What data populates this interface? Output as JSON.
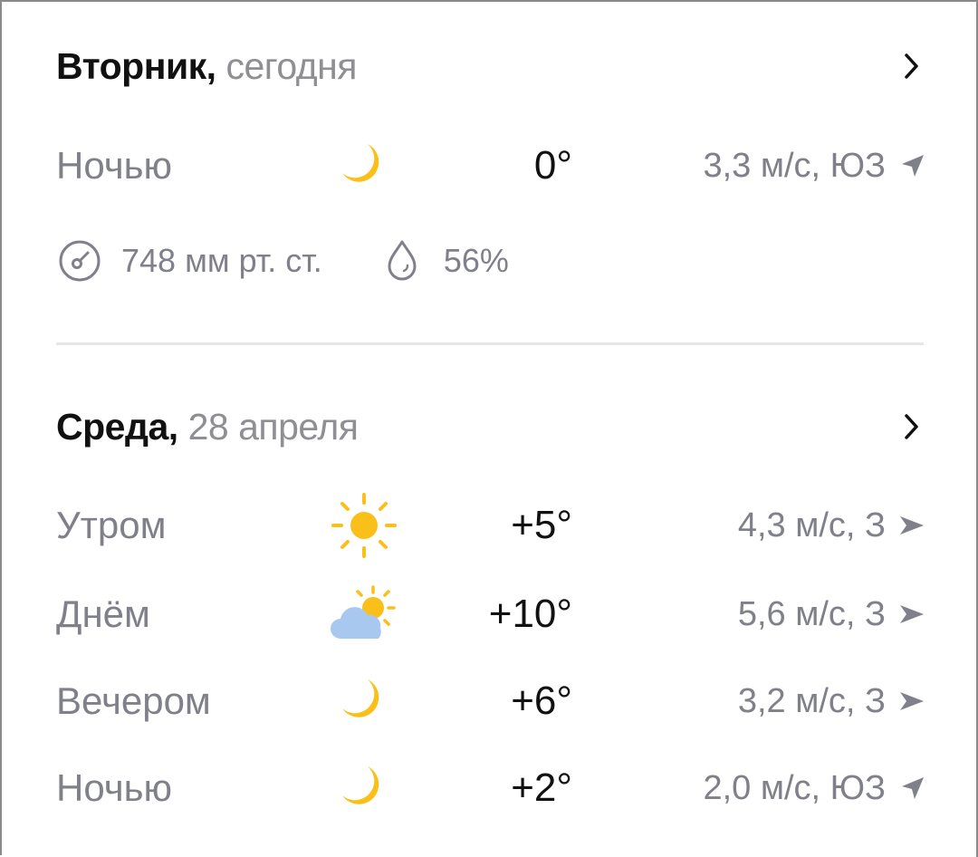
{
  "days": [
    {
      "name": "Вторник,",
      "date": "сегодня",
      "parts": [
        {
          "label": "Ночью",
          "icon": "moon-icon",
          "temp": "0°",
          "wind": "3,3 м/с, ЮЗ",
          "wind_dir": "SW"
        }
      ],
      "pressure": "748 мм рт. ст.",
      "humidity": "56%"
    },
    {
      "name": "Среда,",
      "date": "28 апреля",
      "parts": [
        {
          "label": "Утром",
          "icon": "sun-icon",
          "temp": "+5°",
          "wind": "4,3 м/с, З",
          "wind_dir": "W"
        },
        {
          "label": "Днём",
          "icon": "partly-cloudy-icon",
          "temp": "+10°",
          "wind": "5,6 м/с, З",
          "wind_dir": "W"
        },
        {
          "label": "Вечером",
          "icon": "moon-icon",
          "temp": "+6°",
          "wind": "3,2 м/с, З",
          "wind_dir": "W"
        },
        {
          "label": "Ночью",
          "icon": "moon-icon",
          "temp": "+2°",
          "wind": "2,0 м/с, ЮЗ",
          "wind_dir": "SW"
        }
      ]
    }
  ],
  "colors": {
    "sun": "#fbbf1a",
    "moon": "#fbbf1a",
    "cloud": "#a8c8f0",
    "muted_text": "#80808a",
    "divider": "#e6e6ea"
  }
}
